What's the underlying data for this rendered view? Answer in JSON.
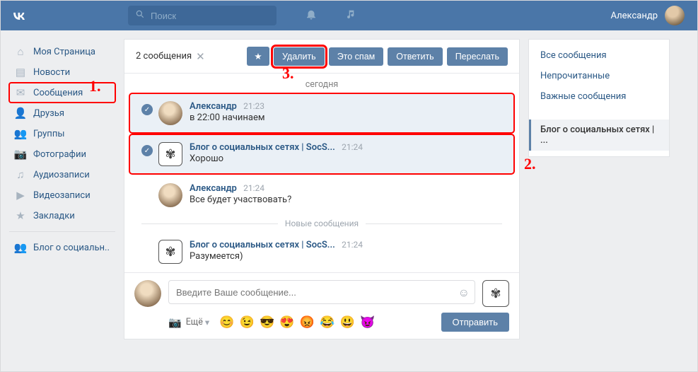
{
  "header": {
    "search_placeholder": "Поиск",
    "user_name": "Александр"
  },
  "sidebar": {
    "items": [
      {
        "icon": "⌂",
        "label": "Моя Страница",
        "name": "sidebar-item-my-page"
      },
      {
        "icon": "▤",
        "label": "Новости",
        "name": "sidebar-item-news"
      },
      {
        "icon": "✉",
        "label": "Сообщения",
        "name": "sidebar-item-messages",
        "highlight": true
      },
      {
        "icon": "👤",
        "label": "Друзья",
        "name": "sidebar-item-friends"
      },
      {
        "icon": "👥",
        "label": "Группы",
        "name": "sidebar-item-groups"
      },
      {
        "icon": "📷",
        "label": "Фотографии",
        "name": "sidebar-item-photos"
      },
      {
        "icon": "♫",
        "label": "Аудиозаписи",
        "name": "sidebar-item-audio"
      },
      {
        "icon": "▶",
        "label": "Видеозаписи",
        "name": "sidebar-item-video"
      },
      {
        "icon": "★",
        "label": "Закладки",
        "name": "sidebar-item-bookmarks"
      }
    ],
    "secondary": {
      "icon": "👥",
      "label": "Блог о социальн..",
      "name": "sidebar-item-blog"
    }
  },
  "toolbar": {
    "selection_count": "2 сообщения",
    "star": "★",
    "delete": "Удалить",
    "spam": "Это спам",
    "reply": "Ответить",
    "forward": "Переслать"
  },
  "timeline": {
    "date_label": "сегодня",
    "new_divider": "Новые сообщения",
    "messages": [
      {
        "selected": true,
        "avatar": "face",
        "name": "Александр",
        "time": "21:23",
        "text": "в 22:00 начинаем"
      },
      {
        "selected": true,
        "avatar": "ornate",
        "name": "Блог о социальных сетях | SocS...",
        "time": "21:24",
        "text": "Хорошо"
      },
      {
        "selected": false,
        "avatar": "face",
        "name": "Александр",
        "time": "21:24",
        "text": "Все будет участвовать?"
      },
      {
        "selected": false,
        "avatar": "ornate",
        "name": "Блог о социальных сетях | SocS...",
        "time": "21:24",
        "text": "Разумеется)"
      }
    ]
  },
  "composer": {
    "placeholder": "Введите Ваше сообщение...",
    "more": "Ещё",
    "send": "Отправить",
    "emojis": [
      "😊",
      "😉",
      "😎",
      "😍",
      "😡",
      "😂",
      "😃",
      "😈"
    ]
  },
  "right_panel": {
    "items": [
      {
        "label": "Все сообщения",
        "name": "rp-all"
      },
      {
        "label": "Непрочитанные",
        "name": "rp-unread"
      },
      {
        "label": "Важные сообщения",
        "name": "rp-important"
      },
      {
        "label": "Блог о социальных сетях | ...",
        "name": "rp-blog",
        "active": true
      }
    ]
  },
  "annotations": {
    "a1": "1.",
    "a2": "2.",
    "a3": "3."
  }
}
